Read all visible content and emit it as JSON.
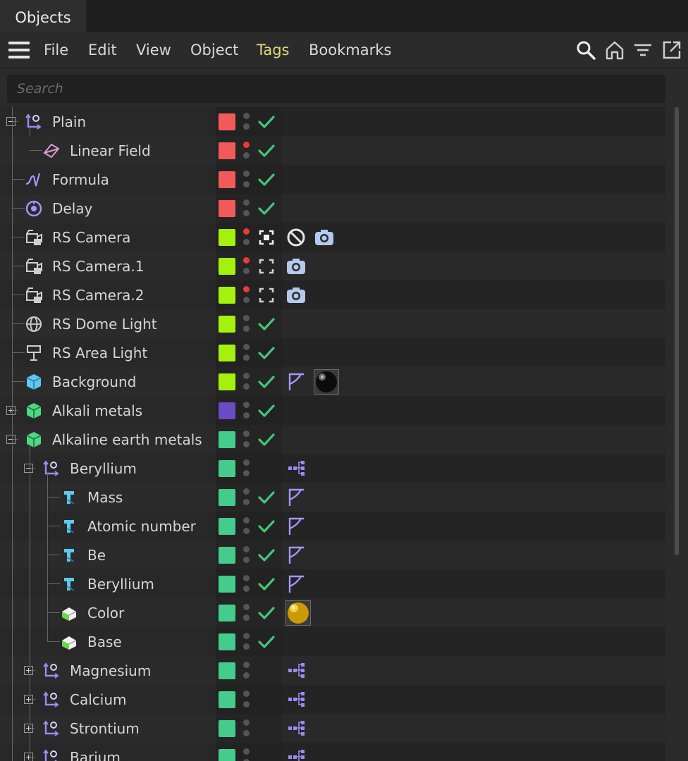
{
  "window": {
    "tab_label": "Objects"
  },
  "menu": {
    "items": [
      {
        "id": "file",
        "label": "File"
      },
      {
        "id": "edit",
        "label": "Edit"
      },
      {
        "id": "view",
        "label": "View"
      },
      {
        "id": "object",
        "label": "Object"
      },
      {
        "id": "tags",
        "label": "Tags"
      },
      {
        "id": "bookmarks",
        "label": "Bookmarks"
      }
    ],
    "tags_color": "#e1d97a"
  },
  "toolbar": {
    "icons": [
      "search-icon",
      "home-icon",
      "filter-icon",
      "new-window-icon"
    ]
  },
  "search": {
    "placeholder": "Search",
    "value": ""
  },
  "colors": {
    "red": "#f25a5a",
    "lime": "#a5f10e",
    "purple": "#6a4cc4",
    "green": "#44cc8c",
    "check": "#44c778",
    "reddot": "#e83a3a",
    "graydot": "#555555"
  },
  "objects": [
    {
      "name": "Plain",
      "level": 0,
      "expander": "minus",
      "icon": "null-object-icon",
      "color": "red",
      "dot": "gray",
      "mark": "check",
      "tags": []
    },
    {
      "name": "Linear Field",
      "level": 1,
      "expander": "none",
      "icon": "linear-field-icon",
      "color": "red",
      "dot": "red",
      "mark": "check",
      "tags": []
    },
    {
      "name": "Formula",
      "level": 0,
      "expander": "none",
      "icon": "formula-icon",
      "color": "red",
      "dot": "gray",
      "mark": "check",
      "tags": []
    },
    {
      "name": "Delay",
      "level": 0,
      "expander": "none",
      "icon": "delay-icon",
      "color": "red",
      "dot": "gray",
      "mark": "check",
      "tags": []
    },
    {
      "name": "RS Camera",
      "level": 0,
      "expander": "none",
      "icon": "rs-camera-icon",
      "color": "lime",
      "dot": "red",
      "mark": "target-active",
      "tags": [
        "protection-tag-icon",
        "camera-tag-icon"
      ]
    },
    {
      "name": "RS Camera.1",
      "level": 0,
      "expander": "none",
      "icon": "rs-camera-icon",
      "color": "lime",
      "dot": "red",
      "mark": "target",
      "tags": [
        "camera-tag-icon"
      ]
    },
    {
      "name": "RS Camera.2",
      "level": 0,
      "expander": "none",
      "icon": "rs-camera-icon",
      "color": "lime",
      "dot": "red",
      "mark": "target",
      "tags": [
        "camera-tag-icon"
      ]
    },
    {
      "name": "RS Dome Light",
      "level": 0,
      "expander": "none",
      "icon": "dome-light-icon",
      "color": "lime",
      "dot": "gray",
      "mark": "check",
      "tags": []
    },
    {
      "name": "RS Area Light",
      "level": 0,
      "expander": "none",
      "icon": "area-light-icon",
      "color": "lime",
      "dot": "gray",
      "mark": "check",
      "tags": []
    },
    {
      "name": "Background",
      "level": 0,
      "expander": "none",
      "icon": "background-icon",
      "color": "lime",
      "dot": "gray",
      "mark": "check",
      "tags": [
        "phong-tag-icon",
        "material-black-icon"
      ]
    },
    {
      "name": "Alkali metals",
      "level": 0,
      "expander": "plus",
      "icon": "cloner-icon",
      "color": "purple",
      "dot": "gray",
      "mark": "check",
      "tags": []
    },
    {
      "name": "Alkaline earth metals",
      "level": 0,
      "expander": "minus",
      "icon": "cloner-icon",
      "color": "green",
      "dot": "gray",
      "mark": "check",
      "tags": []
    },
    {
      "name": "Beryllium",
      "level": 1,
      "expander": "minus",
      "icon": "null-object-icon",
      "color": "green",
      "dot": "gray",
      "mark": "none",
      "tags": [
        "xpresso-tag-icon"
      ]
    },
    {
      "name": "Mass",
      "level": 2,
      "expander": "none",
      "icon": "text-spline-icon",
      "color": "green",
      "dot": "gray",
      "mark": "check",
      "tags": [
        "phong-tag-icon"
      ]
    },
    {
      "name": "Atomic number",
      "level": 2,
      "expander": "none",
      "icon": "text-spline-icon",
      "color": "green",
      "dot": "gray",
      "mark": "check",
      "tags": [
        "phong-tag-icon"
      ]
    },
    {
      "name": "Be",
      "level": 2,
      "expander": "none",
      "icon": "text-spline-icon",
      "color": "green",
      "dot": "gray",
      "mark": "check",
      "tags": [
        "phong-tag-icon"
      ]
    },
    {
      "name": "Beryllium",
      "level": 2,
      "expander": "none",
      "icon": "text-spline-icon",
      "color": "green",
      "dot": "gray",
      "mark": "check",
      "tags": [
        "phong-tag-icon"
      ]
    },
    {
      "name": "Color",
      "level": 2,
      "expander": "none",
      "icon": "primitive-icon",
      "color": "green",
      "dot": "gray",
      "mark": "check",
      "tags": [
        "material-gold-icon"
      ]
    },
    {
      "name": "Base",
      "level": 2,
      "expander": "none",
      "icon": "primitive-icon",
      "color": "green",
      "dot": "gray",
      "mark": "check",
      "tags": []
    },
    {
      "name": "Magnesium",
      "level": 1,
      "expander": "plus",
      "icon": "null-object-icon",
      "color": "green",
      "dot": "gray",
      "mark": "none",
      "tags": [
        "xpresso-tag-icon"
      ]
    },
    {
      "name": "Calcium",
      "level": 1,
      "expander": "plus",
      "icon": "null-object-icon",
      "color": "green",
      "dot": "gray",
      "mark": "none",
      "tags": [
        "xpresso-tag-icon"
      ]
    },
    {
      "name": "Strontium",
      "level": 1,
      "expander": "plus",
      "icon": "null-object-icon",
      "color": "green",
      "dot": "gray",
      "mark": "none",
      "tags": [
        "xpresso-tag-icon"
      ]
    },
    {
      "name": "Barium",
      "level": 1,
      "expander": "plus",
      "icon": "null-object-icon",
      "color": "green",
      "dot": "gray",
      "mark": "none",
      "tags": [
        "xpresso-tag-icon"
      ]
    }
  ]
}
